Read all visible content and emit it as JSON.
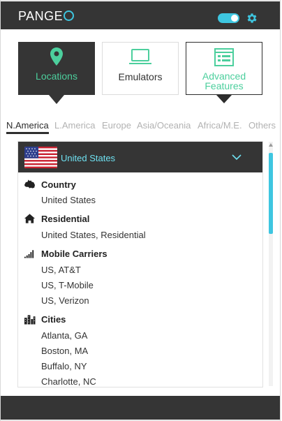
{
  "header": {
    "logo_text": "PANGE",
    "toggle_state": "on",
    "settings_icon": "gear-icon",
    "accent_color": "#3ec6e0"
  },
  "modes": [
    {
      "label": "Locations",
      "icon": "location-pin-icon",
      "selected": true
    },
    {
      "label": "Emulators",
      "icon": "laptop-icon",
      "selected": false
    },
    {
      "label": "Advanced Features",
      "label_line1": "Advanced",
      "label_line2": "Features",
      "icon": "browser-window-icon",
      "selected": false
    }
  ],
  "regions": [
    "N.America",
    "L.America",
    "Europe",
    "Asia/Oceania",
    "Africa/M.E.",
    "Others"
  ],
  "active_region": "N.America",
  "country": {
    "name": "United States",
    "flag": "us-flag-icon"
  },
  "sections": [
    {
      "title": "Country",
      "icon": "australia-map-icon",
      "items": [
        "United States"
      ]
    },
    {
      "title": "Residential",
      "icon": "house-icon",
      "items": [
        "United States, Residential"
      ]
    },
    {
      "title": "Mobile Carriers",
      "icon": "signal-bars-icon",
      "items": [
        "US, AT&T",
        "US, T-Mobile",
        "US, Verizon"
      ]
    },
    {
      "title": "Cities",
      "icon": "city-skyline-icon",
      "items": [
        "Atlanta, GA",
        "Boston, MA",
        "Buffalo, NY",
        "Charlotte, NC"
      ]
    }
  ],
  "colors": {
    "dark": "#353535",
    "green": "#4ccf9d",
    "cyan": "#3ec6e0"
  }
}
